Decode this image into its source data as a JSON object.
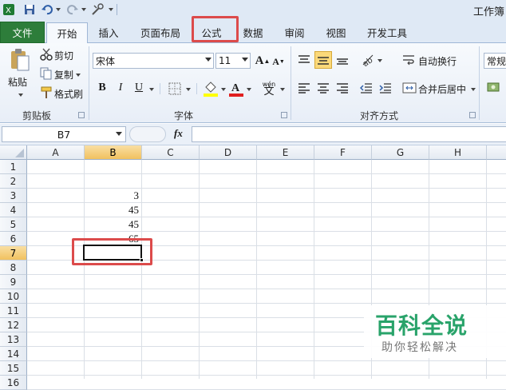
{
  "title_bar": {
    "app_title": "工作簿",
    "icons": [
      "excel-icon",
      "save-icon",
      "undo-icon",
      "redo-icon",
      "customize-icon"
    ]
  },
  "tabs": [
    {
      "label": "文件",
      "active": false
    },
    {
      "label": "开始",
      "active": true
    },
    {
      "label": "插入",
      "active": false
    },
    {
      "label": "页面布局",
      "active": false
    },
    {
      "label": "公式",
      "active": false,
      "highlighted": true
    },
    {
      "label": "数据",
      "active": false
    },
    {
      "label": "审阅",
      "active": false
    },
    {
      "label": "视图",
      "active": false
    },
    {
      "label": "开发工具",
      "active": false
    }
  ],
  "ribbon": {
    "clipboard": {
      "paste": "粘贴",
      "cut": "剪切",
      "copy": "复制",
      "format_painter": "格式刷",
      "label": "剪贴板"
    },
    "font": {
      "font_name": "宋体",
      "font_size": "11",
      "bold": "B",
      "italic": "I",
      "underline": "U",
      "label": "字体",
      "fill_color": "#ffff00",
      "font_color": "#e02020"
    },
    "alignment": {
      "wrap_text": "自动换行",
      "merge_center": "合并后居中",
      "label": "对齐方式"
    },
    "number": {
      "format": "常规"
    }
  },
  "formula_bar": {
    "name_box": "B7",
    "fx": "fx",
    "content": ""
  },
  "sheet": {
    "columns": [
      "A",
      "B",
      "C",
      "D",
      "E",
      "F",
      "G",
      "H"
    ],
    "rows": [
      "1",
      "2",
      "3",
      "4",
      "5",
      "6",
      "7",
      "8",
      "9",
      "10",
      "11",
      "12",
      "13",
      "14",
      "15",
      "16"
    ],
    "selected_cell": "B7",
    "cells": {
      "B3": "3",
      "B4": "45",
      "B5": "45",
      "B6": "65"
    }
  },
  "watermark": {
    "main": "百科全说",
    "sub": "助你轻松解决"
  },
  "colors": {
    "file_tab": "#2d7d3a",
    "highlight_box": "#dc4b4b",
    "selected_header": "#f1c15f",
    "ribbon_bg": "#e8eef7",
    "watermark_green": "#29a36a"
  }
}
